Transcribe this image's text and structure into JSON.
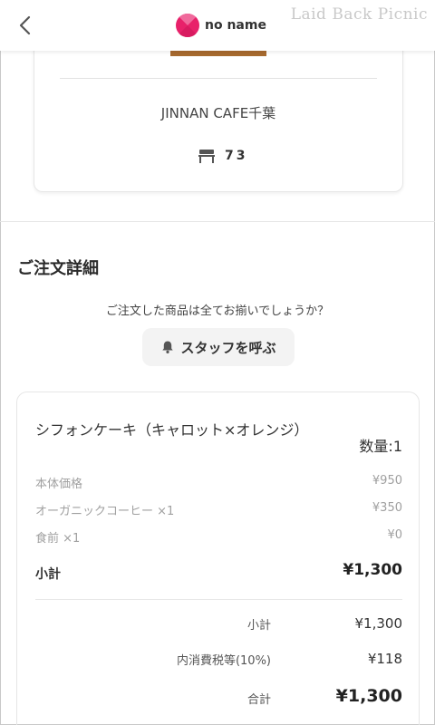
{
  "header": {
    "brand_name": "no name",
    "watermark": "Laid Back Picnic"
  },
  "store": {
    "name": "JINNAN CAFE千葉",
    "table_number": "73"
  },
  "order": {
    "section_title": "ご注文詳細",
    "prompt": "ご注文した商品は全てお揃いでしょうか？",
    "staff_button_label": "スタッフを呼ぶ",
    "item": {
      "name": "シフォンケーキ（キャロット×オレンジ）",
      "quantity": "数量:1",
      "details": [
        {
          "label": "本体価格",
          "price": "¥950"
        },
        {
          "label": "オーガニックコーヒー ×1",
          "price": "¥350"
        },
        {
          "label": "食前 ×1",
          "price": "¥0"
        }
      ],
      "subtotal_label": "小計",
      "subtotal_price": "¥1,300"
    },
    "summary": {
      "subtotal_label": "小計",
      "subtotal_value": "¥1,300",
      "tax_label": "内消費税等(10%)",
      "tax_value": "¥118",
      "total_label": "合計",
      "total_value": "¥1,300"
    }
  },
  "colors": {
    "brand": "#e8216a",
    "accent_bar": "#a86a2f"
  }
}
